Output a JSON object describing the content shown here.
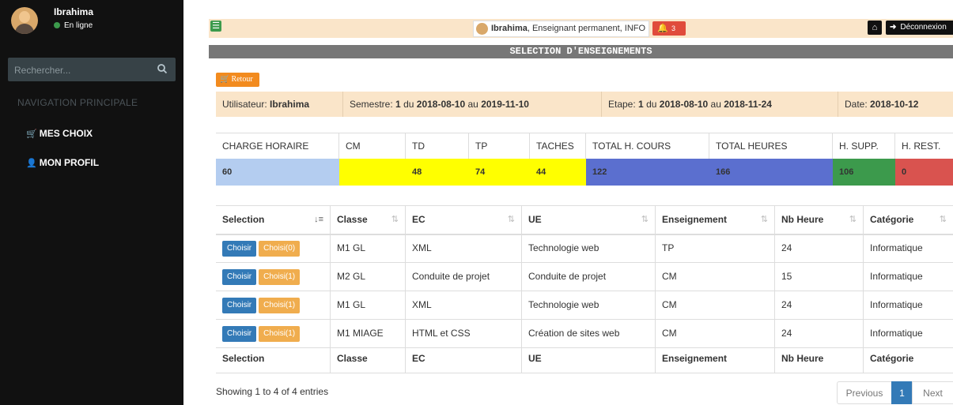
{
  "sidebar": {
    "user_name": "Ibrahima",
    "status": "En ligne",
    "search_placeholder": "Rechercher...",
    "nav_header": "NAVIGATION PRINCIPALE",
    "items": [
      {
        "label": "MES CHOIX",
        "icon": "cart-icon"
      },
      {
        "label": "MON PROFIL",
        "icon": "user-icon"
      }
    ]
  },
  "topbar": {
    "user_bold": "Ibrahima",
    "user_rest": ", Enseignant permanent, INFO",
    "notifications": "3",
    "logout": "Déconnexion"
  },
  "title": "SELECTION D'ENSEIGNEMENTS",
  "retour_label": "Retour",
  "info": {
    "user_label": "Utilisateur:",
    "user_value": "Ibrahima",
    "semestre_label": "Semestre:",
    "semestre_num": "1",
    "semestre_du": "du",
    "semestre_start": "2018-08-10",
    "semestre_au": "au",
    "semestre_end": "2019-11-10",
    "etape_label": "Etape:",
    "etape_num": "1",
    "etape_du": "du",
    "etape_start": "2018-08-10",
    "etape_au": "au",
    "etape_end": "2018-11-24",
    "date_label": "Date:",
    "date_value": "2018-10-12"
  },
  "charge": {
    "headers": [
      "CHARGE HORAIRE",
      "CM",
      "TD",
      "TP",
      "TACHES",
      "TOTAL H. COURS",
      "TOTAL HEURES",
      "H. SUPP.",
      "H. REST."
    ],
    "values": [
      "60",
      "",
      "48",
      "74",
      "44",
      "122",
      "166",
      "106",
      "0"
    ]
  },
  "table": {
    "headers": [
      "Selection",
      "Classe",
      "EC",
      "UE",
      "Enseignement",
      "Nb Heure",
      "Catégorie"
    ],
    "choisir_label": "Choisir",
    "rows": [
      {
        "choisi": "Choisi(0)",
        "classe": "M1 GL",
        "ec": "XML",
        "ue": "Technologie web",
        "enseignement": "TP",
        "nb": "24",
        "categorie": "Informatique"
      },
      {
        "choisi": "Choisi(1)",
        "classe": "M2 GL",
        "ec": "Conduite de projet",
        "ue": "Conduite de projet",
        "enseignement": "CM",
        "nb": "15",
        "categorie": "Informatique"
      },
      {
        "choisi": "Choisi(1)",
        "classe": "M1 GL",
        "ec": "XML",
        "ue": "Technologie web",
        "enseignement": "CM",
        "nb": "24",
        "categorie": "Informatique"
      },
      {
        "choisi": "Choisi(1)",
        "classe": "M1 MIAGE",
        "ec": "HTML et CSS",
        "ue": "Création de sites web",
        "enseignement": "CM",
        "nb": "24",
        "categorie": "Informatique"
      }
    ]
  },
  "showing": "Showing 1 to 4 of 4 entries",
  "pager": {
    "previous": "Previous",
    "page": "1",
    "next": "Next"
  },
  "colors": {
    "charge": "#b4cdf0",
    "cm": "#ffff00",
    "td": "#ffff00",
    "tp": "#ffff00",
    "taches": "#ffff00",
    "total_cours": "#5b6fcf",
    "total_heures": "#5b6fcf",
    "supp": "#3c9a4c",
    "rest": "#d9534f"
  }
}
